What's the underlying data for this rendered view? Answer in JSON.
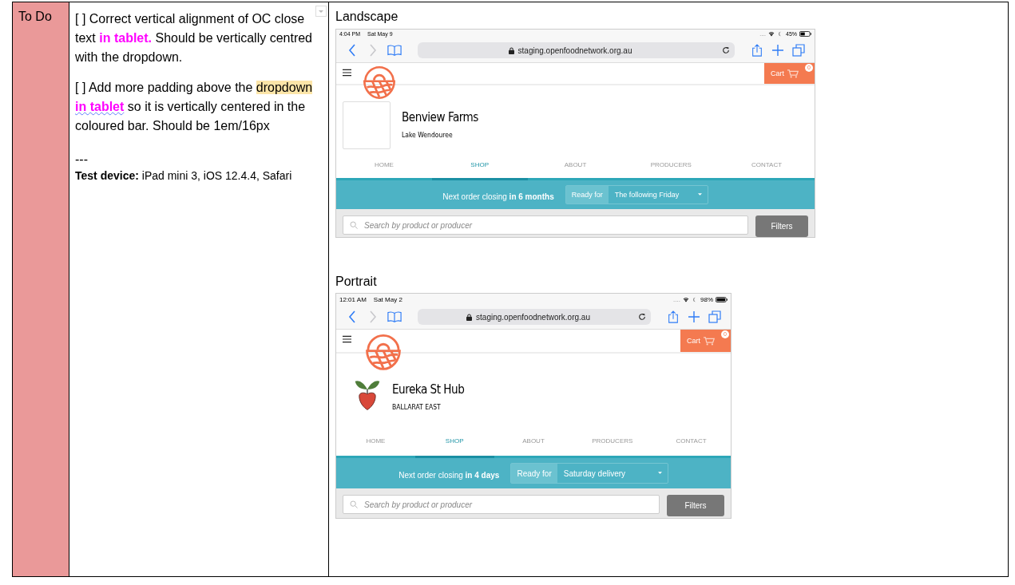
{
  "status": {
    "label": "To Do"
  },
  "notes": [
    {
      "segments": [
        {
          "kind": "text",
          "text": "[ ] Correct vertical alignment of OC close text "
        },
        {
          "kind": "emphasis",
          "text": "in tablet."
        },
        {
          "kind": "text",
          "text": " Should be vertically centred with the dropdown."
        }
      ]
    },
    {
      "segments": [
        {
          "kind": "text",
          "text": "[ ] Add more padding above the "
        },
        {
          "kind": "highlight",
          "text": "dropdown "
        },
        {
          "kind": "spelling",
          "text": "in tablet"
        },
        {
          "kind": "text",
          "text": " so it is vertically centered in the coloured bar. Should be 1em/16px"
        }
      ]
    }
  ],
  "separator": "---",
  "test_device": "**Test device:** iPad mini 3, iOS 12.4.4, Safari",
  "screenshots": [
    {
      "kind": "landscape",
      "caption": "Landscape",
      "time": "4:04 PM",
      "date": "Sat May 9",
      "signal": "....",
      "battery": "45%",
      "url": "staging.openfoodnetwork.org.au",
      "cart": "Cart",
      "cart_count": "0",
      "logo": {
        "kind": "empty"
      },
      "shop_name": "Benview Farms",
      "location": "Lake Wendouree",
      "nav": [
        {
          "label": "HOME",
          "selected": false
        },
        {
          "label": "SHOP",
          "selected": true
        },
        {
          "label": "ABOUT",
          "selected": false
        },
        {
          "label": "PRODUCERS",
          "selected": false
        },
        {
          "label": "CONTACT",
          "selected": false
        }
      ],
      "closing": "Next order closing **in 6 months**",
      "ready_label": "Ready for",
      "ready_value": "The following Friday",
      "search_placeholder": "Search by product or producer",
      "filters": "Filters"
    },
    {
      "kind": "portrait",
      "caption": "Portrait",
      "time": "12:01 AM",
      "date": "Sat May 2",
      "signal": "....",
      "battery": "98%",
      "url": "staging.openfoodnetwork.org.au",
      "cart": "Cart",
      "cart_count": "0",
      "logo": {
        "kind": "drawing"
      },
      "shop_name": "Eureka St Hub",
      "location": "BALLARAT EAST",
      "nav": [
        {
          "label": "HOME",
          "selected": false
        },
        {
          "label": "SHOP",
          "selected": true
        },
        {
          "label": "ABOUT",
          "selected": false
        },
        {
          "label": "PRODUCERS",
          "selected": false
        },
        {
          "label": "CONTACT",
          "selected": false
        }
      ],
      "closing": "Next order closing **in 4 days**",
      "ready_label": "Ready for",
      "ready_value": "Saturday delivery",
      "search_placeholder": "Search by product or producer",
      "filters": "Filters"
    }
  ]
}
